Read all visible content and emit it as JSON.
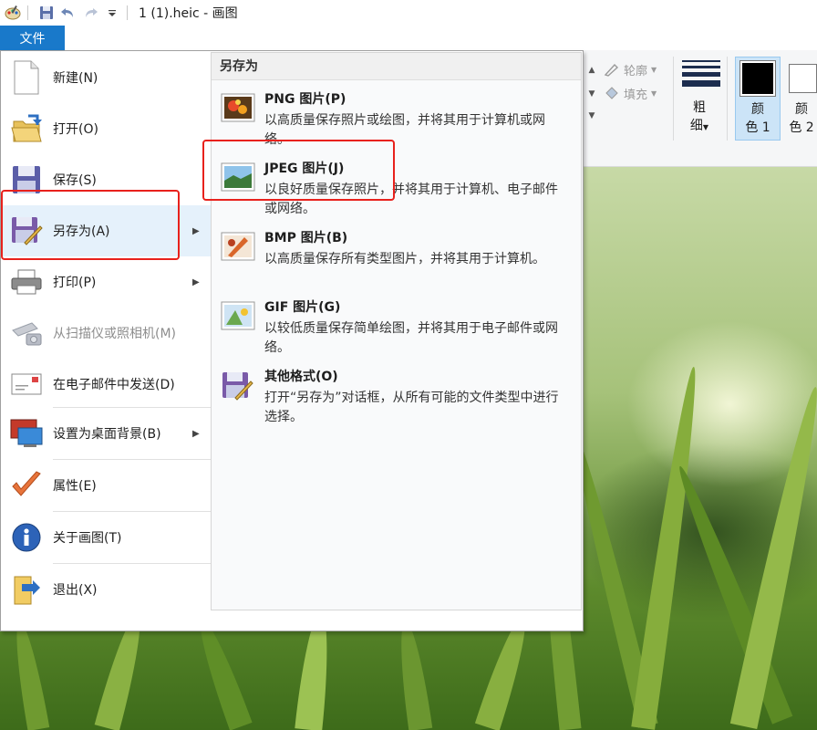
{
  "window": {
    "title": "1 (1).heic - 画图"
  },
  "file_tab": {
    "label": "文件"
  },
  "ribbon": {
    "outline_label": "轮廓",
    "fill_label": "填充",
    "size_label_line1": "粗",
    "size_label_line2": "细",
    "color1_line1": "颜",
    "color1_line2": "色 1",
    "color2_line1": "颜",
    "color2_line2": "色 2"
  },
  "menu": {
    "items": [
      {
        "label": "新建(N)"
      },
      {
        "label": "打开(O)"
      },
      {
        "label": "保存(S)"
      },
      {
        "label": "另存为(A)"
      },
      {
        "label": "打印(P)"
      },
      {
        "label": "从扫描仪或照相机(M)"
      },
      {
        "label": "在电子邮件中发送(D)"
      },
      {
        "label": "设置为桌面背景(B)"
      },
      {
        "label": "属性(E)"
      },
      {
        "label": "关于画图(T)"
      },
      {
        "label": "退出(X)"
      }
    ],
    "save_as_panel": {
      "header": "另存为",
      "formats": [
        {
          "name": "PNG 图片(P)",
          "description": "以高质量保存照片或绘图，并将其用于计算机或网络。"
        },
        {
          "name": "JPEG 图片(J)",
          "description": "以良好质量保存照片，并将其用于计算机、电子邮件或网络。"
        },
        {
          "name": "BMP 图片(B)",
          "description": "以高质量保存所有类型图片，并将其用于计算机。"
        },
        {
          "name": "GIF 图片(G)",
          "description": "以较低质量保存简单绘图，并将其用于电子邮件或网络。"
        },
        {
          "name": "其他格式(O)",
          "description": "打开“另存为”对话框，从所有可能的文件类型中进行选择。"
        }
      ]
    }
  },
  "colors": {
    "accent": "#1979ca",
    "highlight": "#e5f1fb",
    "annotation_red": "#e8211c"
  }
}
